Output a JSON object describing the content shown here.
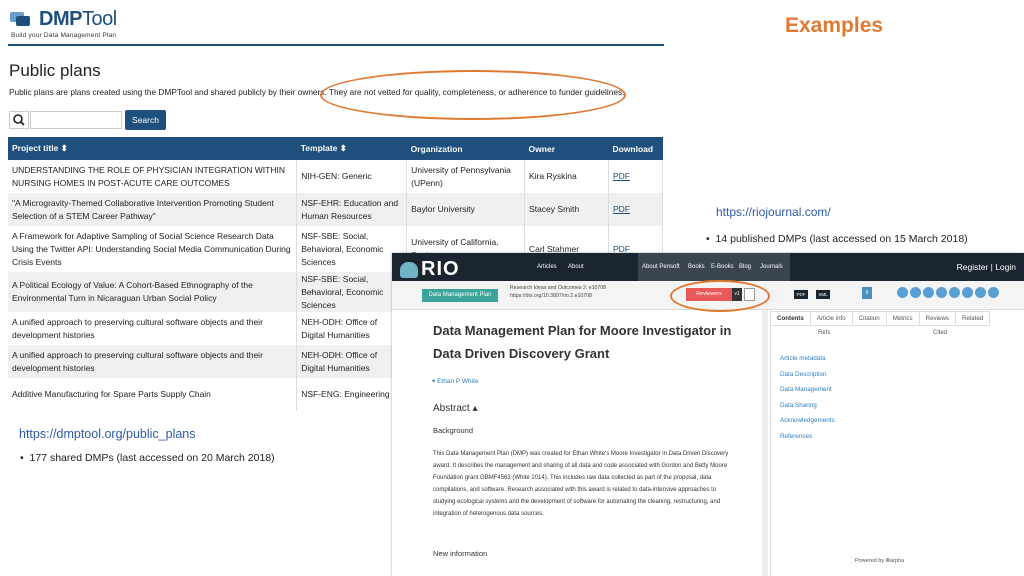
{
  "slide": {
    "heading": "Examples",
    "dmp_url": "https://dmptool.org/public_plans",
    "dmp_bullet": "177 shared DMPs  (last accessed on 20 March 2018)",
    "rio_url": "https://riojournal.com/",
    "rio_bullet": "14 published DMPs  (last accessed on 15 March 2018)",
    "bullet_char": "•"
  },
  "dmptool": {
    "logo_dmp": "DMP",
    "logo_tool": "Tool",
    "tagline": "Build your Data Management Plan",
    "page_title": "Public plans",
    "description": "Public plans are plans created using the DMPTool and shared publicly by their owners. They are not vetted for quality, completeness, or adherence to funder guidelines.",
    "search_button": "Search",
    "search_placeholder": "",
    "search_icon": "magnifier-icon",
    "columns": [
      "Project title ⬍",
      "Template ⬍",
      "Organization",
      "Owner",
      "Download"
    ],
    "rows": [
      {
        "title": "UNDERSTANDING THE ROLE OF PHYSICIAN INTEGRATION WITHIN NURSING HOMES IN POST-ACUTE CARE OUTCOMES",
        "template": "NIH-GEN: Generic",
        "org": "University of Pennsylvania (UPenn)",
        "owner": "Kira Ryskina",
        "download": "PDF"
      },
      {
        "title": "\"A Microgravity-Themed Collaborative Intervention Promoting Student Selection of a STEM Career Pathway\"",
        "template": "NSF-EHR: Education and Human Resources",
        "org": "Baylor University",
        "owner": "Stacey Smith",
        "download": "PDF"
      },
      {
        "title": "A Framework for Adaptive Sampling of Social Science Research Data Using the Twitter API: Understanding Social Media Communication During Crisis Events",
        "template": "NSF-SBE: Social, Behavioral, Economic Sciences",
        "org": "University of California, Davis",
        "owner": "Carl Stahmer",
        "download": "PDF"
      },
      {
        "title": "A Political Ecology of Value: A Cohort-Based Ethnography of the Environmental Turn in Nicaraguan Urban Social Policy",
        "template": "NSF-SBE: Social, Behavioral, Economic Sciences",
        "org": "",
        "owner": "",
        "download": ""
      },
      {
        "title": "A unified approach to preserving cultural software objects and their development histories",
        "template": "NEH-ODH: Office of Digital Humanities",
        "org": "",
        "owner": "",
        "download": ""
      },
      {
        "title": "A unified approach to preserving cultural software objects and their development histories",
        "template": "NEH-ODH: Office of Digital Humanities",
        "org": "",
        "owner": "",
        "download": ""
      },
      {
        "title": "Additive Manufacturing for Spare Parts Supply Chain",
        "template": "NSF-ENG: Engineering",
        "org": "",
        "owner": "",
        "download": ""
      }
    ]
  },
  "rio": {
    "logo": "RIO",
    "nav_left": [
      "Articles",
      "About"
    ],
    "nav_dark": [
      "About Pensoft",
      "Books",
      "E-Books",
      "Blog",
      "Journals"
    ],
    "register_login": "Register | Login",
    "badge": "Data Management Plan",
    "ref_line1": "Research Ideas and Outcomes 2: e10708",
    "ref_line2": "https://doi.org/10.3897/rio.2.e10708",
    "reviewers": "Reviewers",
    "version": "v1",
    "pdf": "PDF",
    "xml": "XML",
    "count_badge": "6",
    "title": "Data Management Plan for Moore Investigator in Data Driven Discovery Grant",
    "author": "▾  Ethan P White",
    "abstract": "Abstract ▴",
    "background": "Background",
    "body": "This Data Management Plan (DMP) was created for Ethan White's Moore Investigator in Data Driven Discovery award. It describes the management and sharing of all data and code associated with Gordon and Betty Moore Foundation grant GBMF4563 (White 2014). This includes raw data collected as part of the proposal, data compilations, and software. Research associated with this award is related to data-intensive approaches to studying ecological systems and the development of software for automating the cleaning, restructuring, and integration of heterogenous data sources.",
    "new_information": "New information",
    "tabs": [
      "Contents",
      "Article info",
      "Citation",
      "Metrics",
      "Reviews",
      "Related"
    ],
    "refs": "Refs",
    "cited": "Cited",
    "side_links": [
      "Article metadata",
      "Data Description",
      "Data Management",
      "Data Sharing",
      "Acknowledgements",
      "References"
    ],
    "powered": "Powered by  ⦾arpha",
    "accent": "#e07a32"
  }
}
